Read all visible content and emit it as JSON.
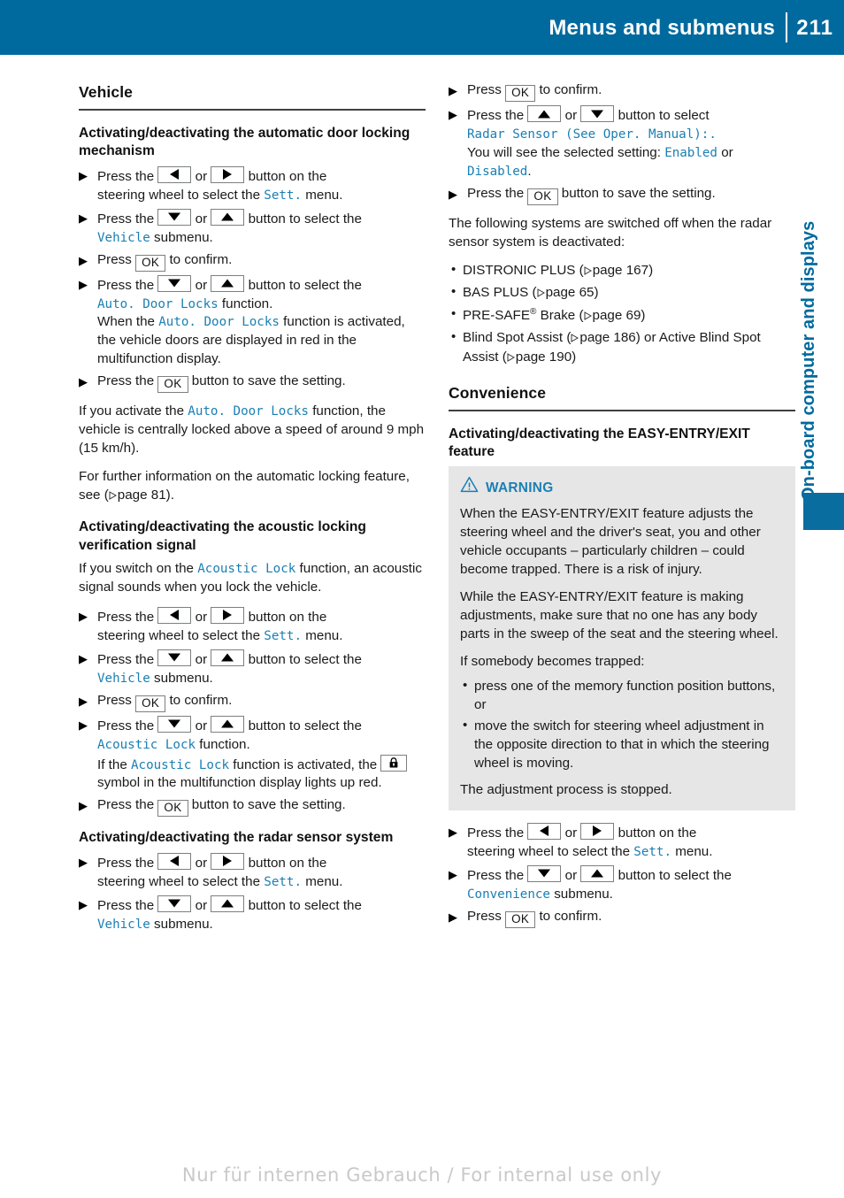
{
  "header": {
    "title": "Menus and submenus",
    "page_number": "211",
    "bar_color": "#006a9e"
  },
  "side_tab": {
    "label": "On-board computer and displays",
    "color": "#006a9e"
  },
  "icons": {
    "arrow_left": "arrow-left-button-icon",
    "arrow_right": "arrow-right-button-icon",
    "arrow_up": "arrow-up-button-icon",
    "arrow_down": "arrow-down-button-icon",
    "ok": "OK",
    "lock": "lock-symbol-icon",
    "warning": "warning-triangle-icon",
    "page_ref": "page-reference-triangle-icon"
  },
  "left_column": {
    "section_title": "Vehicle",
    "sub1": {
      "heading": "Activating/deactivating the automatic door locking mechanism",
      "step1_a": "Press the",
      "step1_or": "or",
      "step1_b": "button on the",
      "step1_c": "steering wheel to select the",
      "step1_menu": "Sett.",
      "step1_d": "menu.",
      "step2_a": "Press the",
      "step2_or": "or",
      "step2_b": "button to select the",
      "step2_menu": "Vehicle",
      "step2_c": "submenu.",
      "step3_a": "Press",
      "step3_b": "to confirm.",
      "step4_a": "Press the",
      "step4_or": "or",
      "step4_b": "button to select the",
      "step4_fn": "Auto. Door Locks",
      "step4_c": "function.",
      "step4_d": "When the",
      "step4_fn2": "Auto. Door Locks",
      "step4_e": "function is activated, the vehicle doors are displayed in red in the multifunction display.",
      "step5_a": "Press the",
      "step5_b": "button to save the setting.",
      "para1_a": "If you activate the",
      "para1_fn": "Auto. Door Locks",
      "para1_b": "function, the vehicle is centrally locked above a speed of around 9 mph (15 km/h).",
      "para2_a": "For further information on the automatic locking feature, see (",
      "para2_page": "page 81",
      "para2_b": ")."
    },
    "sub2": {
      "heading": "Activating/deactivating the acoustic locking verification signal",
      "intro_a": "If you switch on the",
      "intro_fn": "Acoustic Lock",
      "intro_b": "function, an acoustic signal sounds when you lock the vehicle.",
      "step1_a": "Press the",
      "step1_or": "or",
      "step1_b": "button on the",
      "step1_c": "steering wheel to select the",
      "step1_menu": "Sett.",
      "step1_d": "menu.",
      "step2_a": "Press the",
      "step2_or": "or",
      "step2_b": "button to select the",
      "step2_menu": "Vehicle",
      "step2_c": "submenu.",
      "step3_a": "Press",
      "step3_b": "to confirm.",
      "step4_a": "Press the",
      "step4_or": "or",
      "step4_b": "button to select the",
      "step4_fn": "Acoustic Lock",
      "step4_c": "function.",
      "step4_d": "If the",
      "step4_fn2": "Acoustic Lock",
      "step4_e": "function is activated, the",
      "step4_f": "symbol in the multifunction display lights up red.",
      "step5_a": "Press the",
      "step5_b": "button to save the setting."
    },
    "sub3": {
      "heading": "Activating/deactivating the radar sensor system",
      "step1_a": "Press the",
      "step1_or": "or",
      "step1_b": "button on the",
      "step1_c": "steering wheel to select the",
      "step1_menu": "Sett.",
      "step1_d": "menu.",
      "step2_a": "Press the",
      "step2_or": "or",
      "step2_b": "button to select the",
      "step2_menu": "Vehicle",
      "step2_c": "submenu."
    }
  },
  "right_column": {
    "cont": {
      "step1_a": "Press",
      "step1_b": "to confirm.",
      "step2_a": "Press the",
      "step2_or": "or",
      "step2_b": "button to select",
      "step2_fn": "Radar Sensor (See Oper. Manual):",
      "step2_c": "You will see the selected setting:",
      "step2_opt1": "Enabled",
      "step2_mid": "or",
      "step2_opt2": "Disabled",
      "step2_end": ".",
      "step3_a": "Press the",
      "step3_b": "button to save the setting.",
      "para_off": "The following systems are switched off when the radar sensor system is deactivated:",
      "bullets": [
        {
          "text_a": "DISTRONIC PLUS (",
          "page": "page 167",
          "text_b": ")"
        },
        {
          "text_a": "BAS PLUS (",
          "page": "page 65",
          "text_b": ")"
        },
        {
          "text_a": "PRE-SAFE",
          "sup": "®",
          "text_mid": " Brake (",
          "page": "page 69",
          "text_b": ")"
        },
        {
          "text_a": "Blind Spot Assist (",
          "page": "page 186",
          "text_mid2": ") or Active Blind Spot Assist (",
          "page2": "page 190",
          "text_b": ")"
        }
      ]
    },
    "section_title": "Convenience",
    "sub1": {
      "heading": "Activating/deactivating the EASY-ENTRY/EXIT feature",
      "warning": {
        "label": "WARNING",
        "p1": "When the EASY-ENTRY/EXIT feature adjusts the steering wheel and the driver's seat, you and other vehicle occupants – particularly children – could become trapped. There is a risk of injury.",
        "p2": "While the EASY-ENTRY/EXIT feature is making adjustments, make sure that no one has any body parts in the sweep of the seat and the steering wheel.",
        "p3": "If somebody becomes trapped:",
        "bullets": [
          "press one of the memory function position buttons, or",
          "move the switch for steering wheel adjustment in the opposite direction to that in which the steering wheel is moving."
        ],
        "p4": "The adjustment process is stopped."
      },
      "step1_a": "Press the",
      "step1_or": "or",
      "step1_b": "button on the",
      "step1_c": "steering wheel to select the",
      "step1_menu": "Sett.",
      "step1_d": "menu.",
      "step2_a": "Press the",
      "step2_or": "or",
      "step2_b": "button to select the",
      "step2_menu": "Convenience",
      "step2_c": "submenu.",
      "step3_a": "Press",
      "step3_b": "to confirm."
    }
  },
  "footer": {
    "watermark": "Nur für internen Gebrauch / For internal use only"
  }
}
